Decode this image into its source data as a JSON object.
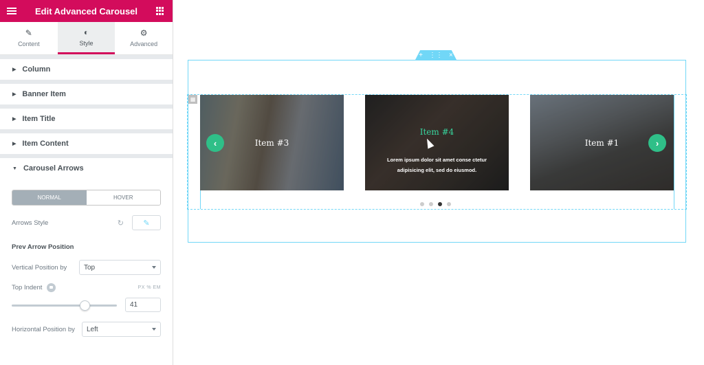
{
  "panel": {
    "title": "Edit Advanced Carousel",
    "tabs": [
      {
        "label": "Content",
        "icon": "pencil-icon"
      },
      {
        "label": "Style",
        "icon": "contrast-icon"
      },
      {
        "label": "Advanced",
        "icon": "gear-icon"
      }
    ],
    "sections": [
      "Column",
      "Banner Item",
      "Item Title",
      "Item Content",
      "Carousel Arrows"
    ],
    "controls": {
      "normal_label": "NORMAL",
      "hover_label": "HOVER",
      "arrows_style_label": "Arrows Style",
      "prev_arrow_heading": "Prev Arrow Position",
      "vertical_position_label": "Vertical Position by",
      "vertical_position_value": "Top",
      "top_indent_label": "Top Indent",
      "units": "PX % EM",
      "top_indent_value": "41",
      "horizontal_position_label": "Horizontal Position by",
      "horizontal_position_value": "Left"
    }
  },
  "carousel": {
    "slides": [
      {
        "title": "Item #3",
        "content": ""
      },
      {
        "title": "Item #4",
        "content": "Lorem ipsum dolor sit amet conse ctetur adipisicing elit, sed do eiusmod."
      },
      {
        "title": "Item #1",
        "content": ""
      }
    ],
    "dots": 4,
    "active_dot": 3
  },
  "colors": {
    "brand": "#d30c5c",
    "editor_accent": "#71d7f7",
    "arrow_bg": "#2fbf88",
    "title_highlight": "#37d59e"
  }
}
